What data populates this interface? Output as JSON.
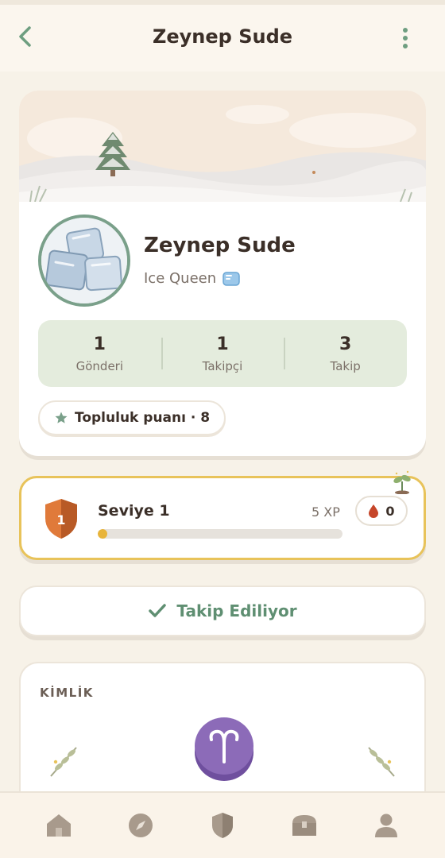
{
  "header": {
    "title": "Zeynep Sude",
    "back_icon": "chevron-left-icon",
    "more_icon": "kebab-menu-icon"
  },
  "profile": {
    "name": "Zeynep Sude",
    "subtitle": "Ice Queen",
    "subtitle_icon": "ice-cube-icon",
    "stats": [
      {
        "value": "1",
        "label": "Gönderi"
      },
      {
        "value": "1",
        "label": "Takipçi"
      },
      {
        "value": "3",
        "label": "Takip"
      }
    ],
    "community_points": "Topluluk puanı · 8"
  },
  "level": {
    "label": "Seviye 1",
    "badge_number": "1",
    "xp": "5 XP",
    "progress_fraction": 0.04,
    "drops": "0"
  },
  "follow_button": {
    "label": "Takip Ediliyor"
  },
  "identity": {
    "section_title": "KİMLİK",
    "zodiac_icon": "aries-icon"
  },
  "bottom_nav": [
    "home-icon",
    "compass-icon",
    "shield-icon",
    "treasure-chest-icon",
    "profile-icon"
  ],
  "colors": {
    "accent_green": "#5f8f72",
    "stats_bg": "#e4ecdd",
    "level_border": "#e8c35a",
    "background": "#f7f2e8"
  }
}
